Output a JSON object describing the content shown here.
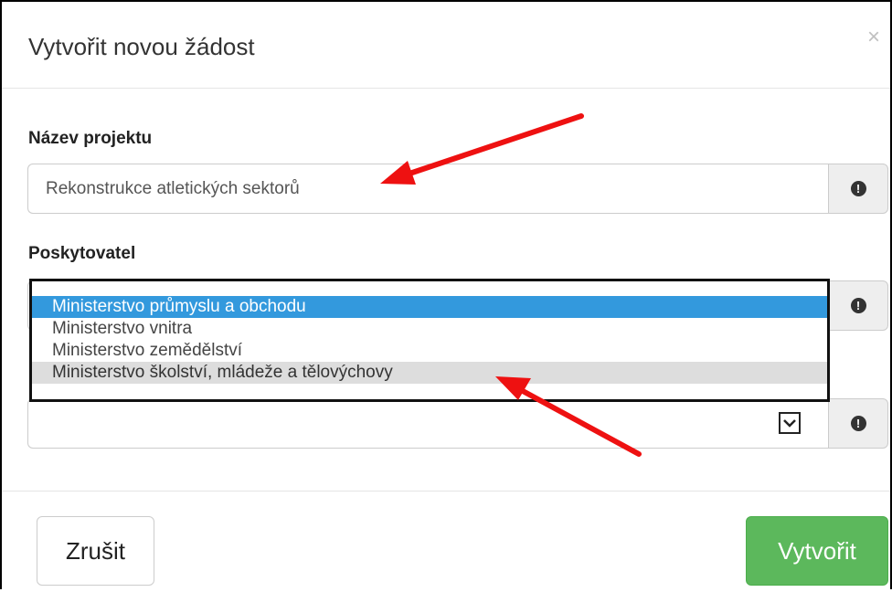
{
  "dialog": {
    "title": "Vytvořit novou žádost",
    "close_label": "×"
  },
  "fields": {
    "project_name": {
      "label": "Název projektu",
      "value": "Rekonstrukce atletických sektorů",
      "help_icon": "exclamation-circle-icon"
    },
    "provider": {
      "label": "Poskytovatel",
      "help_icon": "exclamation-circle-icon",
      "options": [
        "Ministerstvo průmyslu a obchodu",
        "Ministerstvo vnitra",
        "Ministerstvo zemědělství",
        "Ministerstvo školství, mládeže a tělovýchovy"
      ],
      "selected_index": 0,
      "hovered_index": 3
    },
    "third_select": {
      "value": "",
      "help_icon": "exclamation-circle-icon"
    }
  },
  "footer": {
    "cancel_label": "Zrušit",
    "create_label": "Vytvořit"
  },
  "colors": {
    "selected_option": "#3399dd",
    "hovered_option": "#dddddd",
    "create_button": "#5cb85c",
    "annotation_arrow": "#ee1111"
  }
}
